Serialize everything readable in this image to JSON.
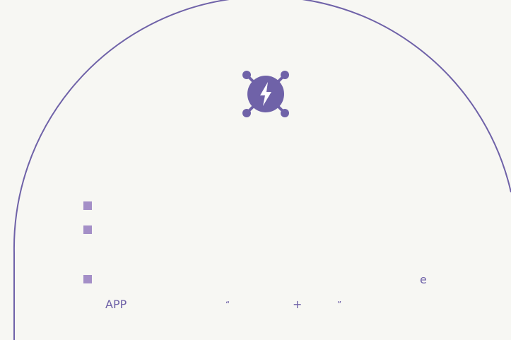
{
  "colors": {
    "background": "#f7f7f3",
    "accent": "#6f62a8",
    "bullet": "#a48fc7"
  },
  "logo": {
    "icon": "lightning-bolt-network-icon"
  },
  "bullets": [
    {
      "text": ""
    },
    {
      "text": ""
    },
    {
      "line1_end": "e",
      "line2": {
        "app": "APP",
        "open_quote": "“",
        "plus": "+",
        "close_quote": "”"
      }
    }
  ]
}
